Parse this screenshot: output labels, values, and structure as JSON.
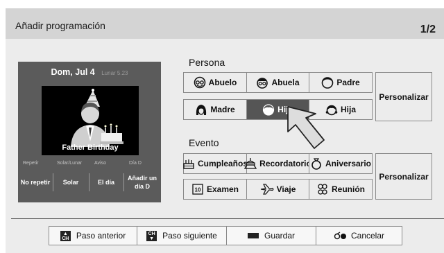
{
  "header": {
    "title": "Añadir programación",
    "page": "1/2"
  },
  "preview": {
    "date": "Dom, Jul 4",
    "lunar": "Lunar 5.23",
    "caption": "Father Birthday",
    "columns": [
      "Repetir",
      "Solar/Lunar",
      "Aviso",
      "Día D"
    ],
    "values": [
      "No repetir",
      "Solar",
      "El día",
      "Añadir un día D"
    ]
  },
  "persona": {
    "label": "Persona",
    "options": [
      {
        "label": "Abuelo",
        "icon": "grandfather-icon"
      },
      {
        "label": "Abuela",
        "icon": "grandmother-icon"
      },
      {
        "label": "Padre",
        "icon": "father-icon"
      },
      {
        "label": "Madre",
        "icon": "mother-icon"
      },
      {
        "label": "Hijo",
        "icon": "son-icon",
        "selected": true
      },
      {
        "label": "Hija",
        "icon": "daughter-icon"
      }
    ],
    "custom": "Personalizar"
  },
  "evento": {
    "label": "Evento",
    "options": [
      {
        "label": "Cumpleaños",
        "icon": "cake-icon"
      },
      {
        "label": "Recordatorio",
        "icon": "memorial-icon"
      },
      {
        "label": "Aniversario",
        "icon": "ring-icon"
      },
      {
        "label": "Examen",
        "icon": "exam-icon"
      },
      {
        "label": "Viaje",
        "icon": "plane-icon"
      },
      {
        "label": "Reunión",
        "icon": "meeting-icon"
      }
    ],
    "custom": "Personalizar"
  },
  "bottom": {
    "prev": "Paso anterior",
    "prev_key": "CH",
    "next": "Paso siguiente",
    "next_key": "CH",
    "save": "Guardar",
    "cancel": "Cancelar"
  },
  "colors": {
    "selected": "#555555",
    "panel": "#5b5b5b",
    "background": "#ececec"
  }
}
